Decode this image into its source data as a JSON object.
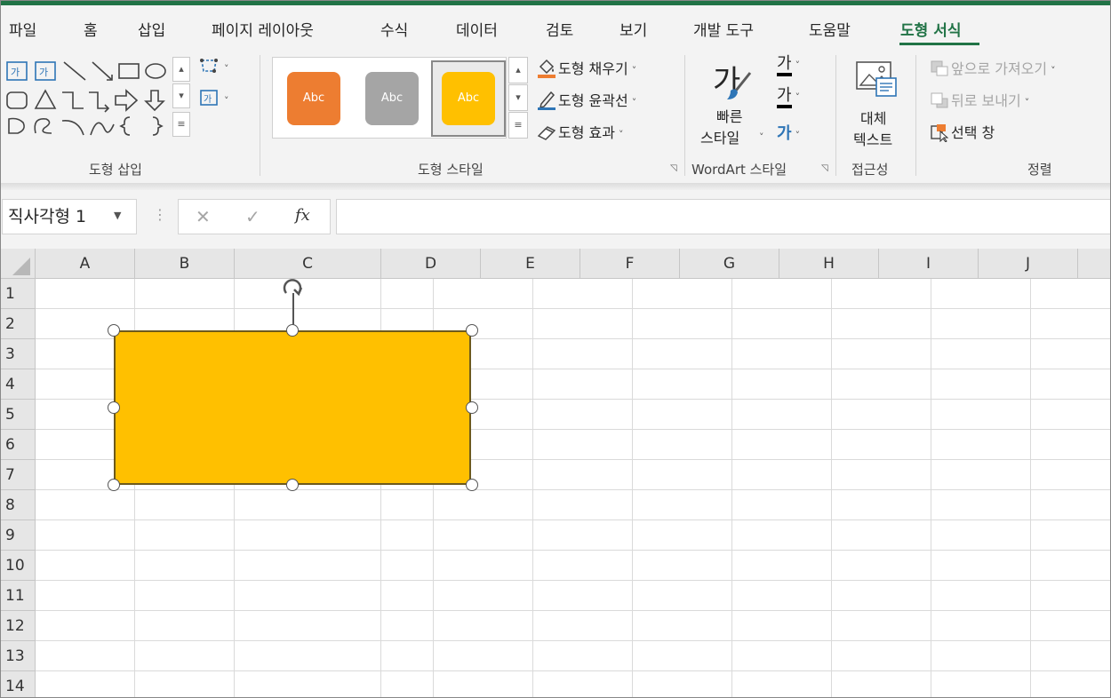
{
  "tabs": [
    "파일",
    "홈",
    "삽입",
    "페이지 레이아웃",
    "수식",
    "데이터",
    "검토",
    "보기",
    "개발 도구",
    "도움말",
    "도형 서식"
  ],
  "active_tab": "도형 서식",
  "ribbon": {
    "insert_shapes": {
      "label": "도형 삽입"
    },
    "shape_styles": {
      "label": "도형 스타일",
      "swatches": [
        {
          "text": "Abc",
          "color": "#ed7d31"
        },
        {
          "text": "Abc",
          "color": "#a5a5a5"
        },
        {
          "text": "Abc",
          "color": "#ffc000"
        }
      ],
      "fill": "도형 채우기",
      "outline": "도형 윤곽선",
      "effects": "도형 효과"
    },
    "wordart": {
      "label": "WordArt 스타일",
      "quick_styles_line1": "빠른",
      "quick_styles_line2": "스타일",
      "text_fill_glyph": "가",
      "text_outline_glyph": "가",
      "text_effects_glyph": "가",
      "big_glyph": "가"
    },
    "accessibility": {
      "label": "접근성",
      "alt_text_line1": "대체",
      "alt_text_line2": "텍스트"
    },
    "arrange": {
      "label": "정렬",
      "bring_forward": "앞으로 가져오기",
      "send_backward": "뒤로 보내기",
      "selection_pane": "선택 창"
    }
  },
  "formula_bar": {
    "name_box": "직사각형 1",
    "cancel": "✕",
    "confirm": "✓",
    "fx": "fx",
    "value": ""
  },
  "sheet": {
    "columns": [
      "A",
      "B",
      "C",
      "D",
      "E",
      "F",
      "G",
      "H",
      "I",
      "J"
    ],
    "rows": [
      "1",
      "2",
      "3",
      "4",
      "5",
      "6",
      "7",
      "8",
      "9",
      "10",
      "11",
      "12",
      "13",
      "14"
    ],
    "selected_shape": {
      "name": "직사각형 1",
      "fill": "#ffc000"
    }
  }
}
